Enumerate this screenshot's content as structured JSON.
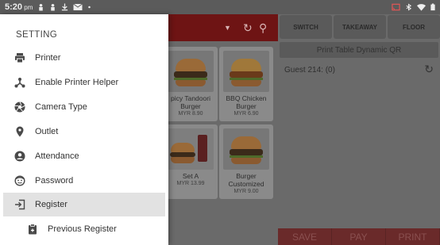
{
  "status_bar": {
    "time": "5:20",
    "ampm": "pm"
  },
  "drawer": {
    "title": "SETTING",
    "items": [
      {
        "label": "Printer",
        "icon": "printer-icon"
      },
      {
        "label": "Enable Printer Helper",
        "icon": "network-icon"
      },
      {
        "label": "Camera Type",
        "icon": "camera-shutter-icon"
      },
      {
        "label": "Outlet",
        "icon": "location-pin-icon"
      },
      {
        "label": "Attendance",
        "icon": "account-circle-icon"
      },
      {
        "label": "Password",
        "icon": "face-icon"
      },
      {
        "label": "Register",
        "icon": "login-icon",
        "selected": true
      },
      {
        "label": "Previous Register",
        "icon": "clipboard-icon",
        "sub": true
      }
    ]
  },
  "menu_grid": {
    "items": [
      {
        "name": "Spicy Tandoori Burger",
        "name_visible": "picy Tandoori\nBurger",
        "price": "MYR 8.90"
      },
      {
        "name": "BBQ Chicken Burger",
        "name_visible": "BBQ Chicken\nBurger",
        "price": "MYR 6.90"
      },
      {
        "name": "Set A",
        "price": "MYR 13.99"
      },
      {
        "name": "Burger Customized",
        "name_visible": "Burger\nCustomized",
        "price": "MYR 9.00"
      }
    ]
  },
  "order_panel": {
    "tabs": [
      "SWITCH",
      "TAKEAWAY",
      "FLOOR"
    ],
    "print_qr_label": "Print Table Dynamic QR",
    "guest_label": "Guest 214: (0)",
    "actions": [
      "SAVE",
      "PAY",
      "PRINT"
    ]
  },
  "colors": {
    "drawer_bg": "#ffffff",
    "selected_bg": "#e2e2e2",
    "topbar_red": "#6e1414",
    "scrim": "#5f5f5f"
  }
}
